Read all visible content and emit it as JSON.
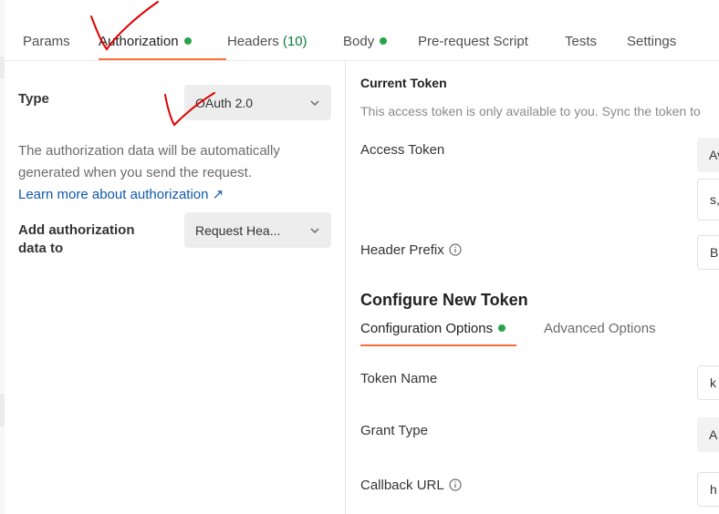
{
  "tabs": [
    {
      "label": "Params"
    },
    {
      "label": "Authorization"
    },
    {
      "label": "Headers",
      "count": "(10)"
    },
    {
      "label": "Body"
    },
    {
      "label": "Pre-request Script"
    },
    {
      "label": "Tests"
    },
    {
      "label": "Settings"
    }
  ],
  "auth": {
    "type_label": "Type",
    "type_value": "OAuth 2.0",
    "description": "The authorization data will be automatically generated when you send the request.",
    "learn_more": "Learn more about authorization ↗",
    "add_to_label": "Add authorization data to",
    "add_to_value": "Request Hea..."
  },
  "current_token": {
    "title": "Current Token",
    "subtitle": "This access token is only available to you. Sync the token to",
    "access_token_label": "Access Token",
    "access_token_value_1": "Av",
    "access_token_value_2": "s,",
    "header_prefix_label": "Header Prefix",
    "header_prefix_value": "B"
  },
  "configure": {
    "title": "Configure New Token",
    "subtabs": [
      {
        "label": "Configuration Options"
      },
      {
        "label": "Advanced Options"
      }
    ],
    "token_name_label": "Token Name",
    "token_name_value": "k",
    "grant_type_label": "Grant Type",
    "grant_type_value": "A",
    "callback_url_label": "Callback URL",
    "callback_url_value": "h"
  },
  "colors": {
    "accent": "#ff6c37",
    "success": "#2aa24a",
    "link": "#0f58b0",
    "annotation": "#e00000"
  }
}
